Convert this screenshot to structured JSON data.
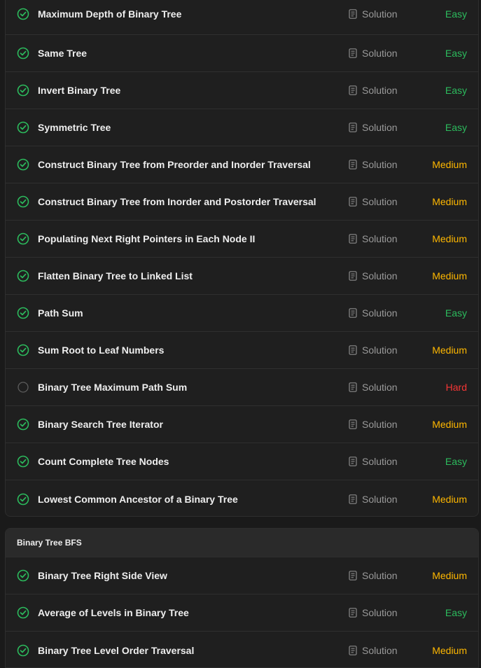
{
  "colors": {
    "easy": "#2cbb5d",
    "medium": "#ffb800",
    "hard": "#f63636",
    "solved": "#2cbb5d",
    "unsolved": "#5c5c5c"
  },
  "group_1": {
    "problems": [
      {
        "title": "Maximum Depth of Binary Tree",
        "solution": "Solution",
        "difficulty": "Easy",
        "solved": true
      },
      {
        "title": "Same Tree",
        "solution": "Solution",
        "difficulty": "Easy",
        "solved": true
      },
      {
        "title": "Invert Binary Tree",
        "solution": "Solution",
        "difficulty": "Easy",
        "solved": true
      },
      {
        "title": "Symmetric Tree",
        "solution": "Solution",
        "difficulty": "Easy",
        "solved": true
      },
      {
        "title": "Construct Binary Tree from Preorder and Inorder Traversal",
        "solution": "Solution",
        "difficulty": "Medium",
        "solved": true
      },
      {
        "title": "Construct Binary Tree from Inorder and Postorder Traversal",
        "solution": "Solution",
        "difficulty": "Medium",
        "solved": true
      },
      {
        "title": "Populating Next Right Pointers in Each Node II",
        "solution": "Solution",
        "difficulty": "Medium",
        "solved": true
      },
      {
        "title": "Flatten Binary Tree to Linked List",
        "solution": "Solution",
        "difficulty": "Medium",
        "solved": true
      },
      {
        "title": "Path Sum",
        "solution": "Solution",
        "difficulty": "Easy",
        "solved": true
      },
      {
        "title": "Sum Root to Leaf Numbers",
        "solution": "Solution",
        "difficulty": "Medium",
        "solved": true
      },
      {
        "title": "Binary Tree Maximum Path Sum",
        "solution": "Solution",
        "difficulty": "Hard",
        "solved": false
      },
      {
        "title": "Binary Search Tree Iterator",
        "solution": "Solution",
        "difficulty": "Medium",
        "solved": true
      },
      {
        "title": "Count Complete Tree Nodes",
        "solution": "Solution",
        "difficulty": "Easy",
        "solved": true
      },
      {
        "title": "Lowest Common Ancestor of a Binary Tree",
        "solution": "Solution",
        "difficulty": "Medium",
        "solved": true
      }
    ]
  },
  "group_2": {
    "title": "Binary Tree BFS",
    "problems": [
      {
        "title": "Binary Tree Right Side View",
        "solution": "Solution",
        "difficulty": "Medium",
        "solved": true
      },
      {
        "title": "Average of Levels in Binary Tree",
        "solution": "Solution",
        "difficulty": "Easy",
        "solved": true
      },
      {
        "title": "Binary Tree Level Order Traversal",
        "solution": "Solution",
        "difficulty": "Medium",
        "solved": true
      }
    ]
  },
  "icons": {
    "solved": "check-circle-icon",
    "unsolved": "empty-circle-icon",
    "solution": "document-icon"
  }
}
